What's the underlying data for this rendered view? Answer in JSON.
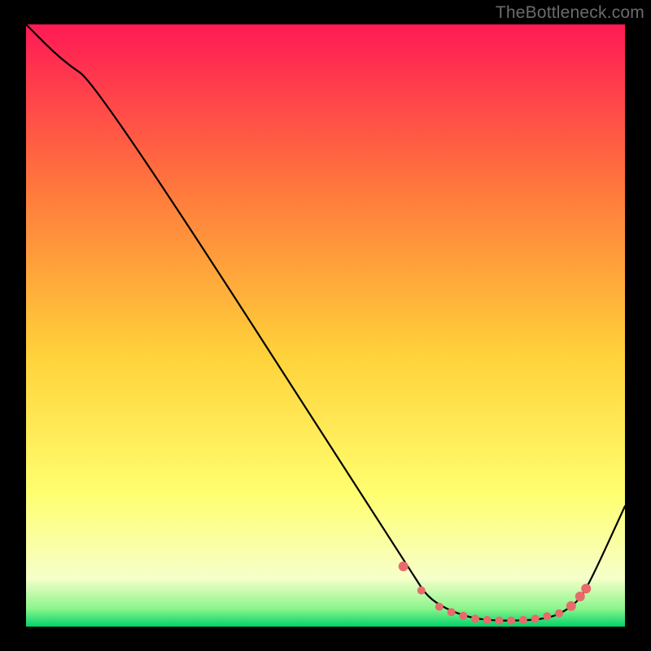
{
  "watermark": "TheBottleneck.com",
  "colors": {
    "gradient_top": "#ff1a55",
    "gradient_mid_upper": "#ff7a3c",
    "gradient_mid": "#ffd23a",
    "gradient_low": "#ffff70",
    "gradient_pale": "#f6ffc9",
    "gradient_green1": "#8cf58c",
    "gradient_green2": "#00d36b",
    "line": "#000000",
    "marker": "#e86a6a"
  },
  "chart_data": {
    "type": "line",
    "title": "",
    "xlabel": "",
    "ylabel": "",
    "xlim": [
      0,
      100
    ],
    "ylim": [
      0,
      100
    ],
    "series": [
      {
        "name": "curve",
        "x": [
          0,
          6,
          12,
          65,
          67,
          70,
          74,
          78,
          82,
          86,
          89,
          92,
          94,
          100
        ],
        "y": [
          100,
          94,
          90,
          8,
          5,
          3,
          1.5,
          1,
          1,
          1.2,
          2,
          4,
          7,
          20
        ]
      }
    ],
    "markers": {
      "name": "highlight-points",
      "x": [
        63,
        66,
        69,
        71,
        73,
        75,
        77,
        79,
        81,
        83,
        85,
        87,
        89,
        91,
        92.5,
        93.5
      ],
      "y": [
        10,
        6,
        3.3,
        2.4,
        1.8,
        1.3,
        1.1,
        1.0,
        1.0,
        1.1,
        1.3,
        1.7,
        2.2,
        3.4,
        5.0,
        6.3
      ]
    }
  }
}
